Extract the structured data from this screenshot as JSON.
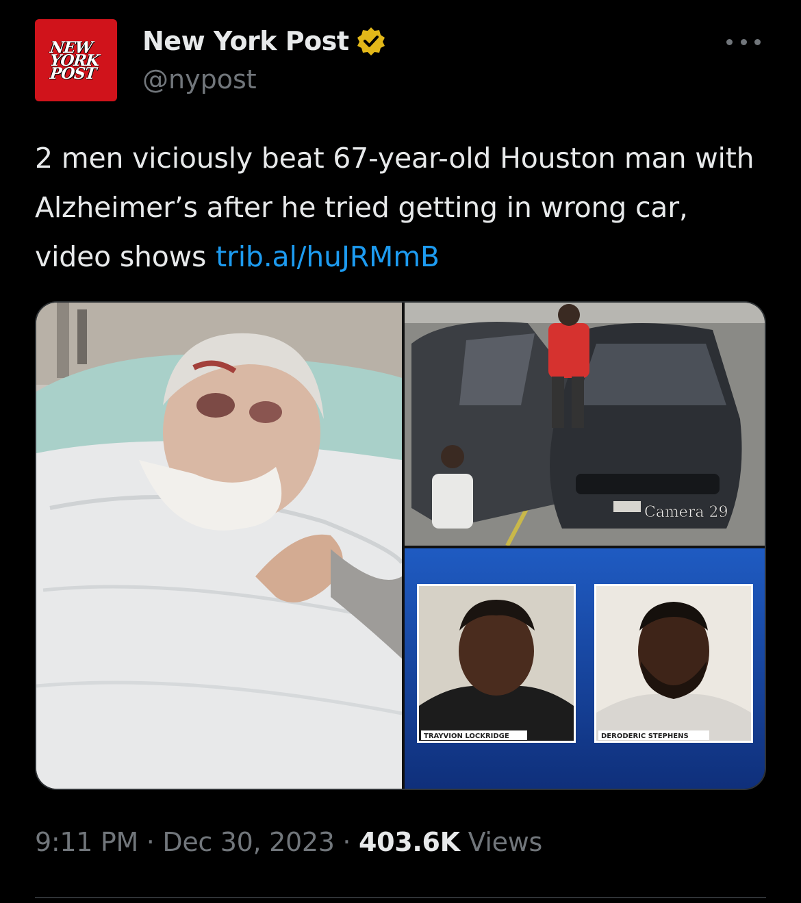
{
  "account": {
    "logo_text": [
      "NEW",
      "YORK",
      "POST"
    ],
    "display_name": "New York Post",
    "handle": "@nypost",
    "verified_badge": "gold-check-icon"
  },
  "tweet": {
    "text": "2 men viciously beat 67-year-old Houston man with Alzheimer’s after he tried getting in wrong car, video shows",
    "link": "trib.al/huJRMmB"
  },
  "media": {
    "camera_overlay": "Camera  29",
    "mugshots": [
      {
        "caption": "TRAYVION LOCKRIDGE"
      },
      {
        "caption": "DERODERIC STEPHENS"
      }
    ]
  },
  "meta": {
    "time": "9:11 PM",
    "separator": "·",
    "date": "Dec 30, 2023",
    "views_count": "403.6K",
    "views_label": "Views"
  },
  "colors": {
    "background": "#000000",
    "text": "#e7e9ea",
    "muted": "#71767b",
    "link": "#1d9bf0",
    "brand_red": "#d0131b",
    "verified_gold": "#e2b719"
  }
}
